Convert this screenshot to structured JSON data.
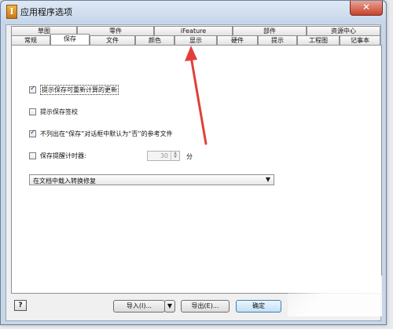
{
  "window": {
    "title": "应用程序选项",
    "app_icon": "I",
    "close_glyph": "✕"
  },
  "tabs_row1": [
    "草图",
    "零件",
    "iFeature",
    "部件",
    "资源中心"
  ],
  "tabs_row2": [
    "常规",
    "保存",
    "文件",
    "颜色",
    "显示",
    "硬件",
    "提示",
    "工程图",
    "记事本"
  ],
  "active_tab": "保存",
  "options": {
    "prompt_recompute": "提示保存可重新计算的更新",
    "prompt_checkin": "提示保存签校",
    "no_default_no": "不列出在“保存”对话框中默认为“否”的参考文件",
    "save_reminder": "保存提醒计时器:"
  },
  "checks": {
    "prompt_recompute": true,
    "prompt_checkin": false,
    "no_default_no": true,
    "save_reminder": false
  },
  "spinner": {
    "value": "30",
    "up": "▲",
    "down": "▼",
    "unit": "分"
  },
  "dropdown": {
    "value": "在文档中载入转换修复",
    "arrow": "▼"
  },
  "buttons": {
    "help": "?",
    "import": "导入(I)...",
    "import_arrow": "▼",
    "export": "导出(E)...",
    "ok": "确定"
  },
  "accent": {
    "arrow": "#e0403a"
  }
}
